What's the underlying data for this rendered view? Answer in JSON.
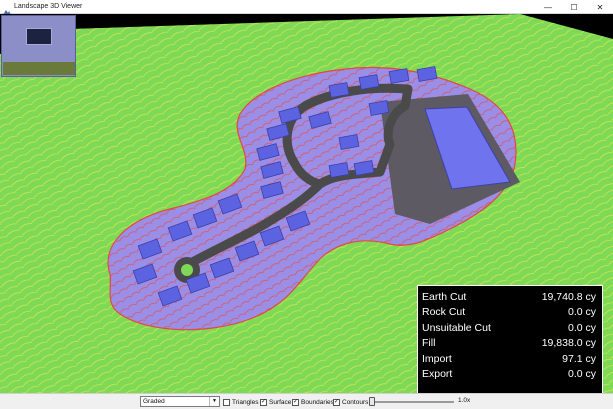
{
  "window": {
    "title": "Landscape 3D Viewer",
    "minimize_glyph": "—",
    "maximize_glyph": "☐",
    "close_glyph": "✕"
  },
  "stats": [
    {
      "label": "Earth Cut",
      "value": "19,740.8 cy"
    },
    {
      "label": "Rock Cut",
      "value": "0.0 cy"
    },
    {
      "label": "Unsuitable Cut",
      "value": "0.0 cy"
    },
    {
      "label": "Fill",
      "value": "19,838.0 cy"
    },
    {
      "label": "Import",
      "value": "97.1 cy"
    },
    {
      "label": "Export",
      "value": "0.0 cy"
    }
  ],
  "toolbar": {
    "mode_value": "Graded",
    "dropdown_icon": "chevron-down-icon",
    "checkboxes": [
      {
        "label": "Triangles",
        "checked": false
      },
      {
        "label": "Surface",
        "checked": true
      },
      {
        "label": "Boundaries",
        "checked": true
      },
      {
        "label": "Contours",
        "checked": true
      }
    ],
    "zoom_label": "1.0x",
    "slider_value": 0
  },
  "colors": {
    "terrain": "#7ed957",
    "graded_pad": "#9b8ee6",
    "lots": "#5b63e0",
    "road": "#4a4a4a",
    "building": "#5d5a63",
    "roof": "#6f74ee",
    "contour_red": "#e8473e",
    "contour_yellow": "#e6e84a"
  }
}
